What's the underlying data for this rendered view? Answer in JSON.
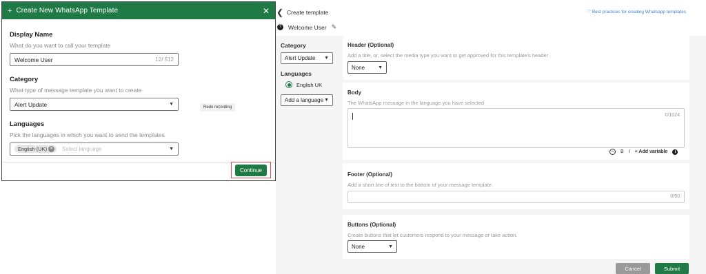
{
  "modal": {
    "title": "Create New WhatsApp Template",
    "plus_glyph": "+",
    "close_glyph": "✕",
    "display_name": {
      "label": "Display Name",
      "help": "What do you want to call your template",
      "value": "Welcome User",
      "counter": "12/ 512"
    },
    "category": {
      "label": "Category",
      "help": "What type of message template you want to create",
      "value": "Alert Update"
    },
    "languages": {
      "label": "Languages",
      "help": "Pick the languages in which you want to send the templates",
      "chip": "English (UK)",
      "placeholder": "Select language"
    },
    "continue_label": "Continue"
  },
  "tooltip": {
    "text": "Redo recording"
  },
  "page": {
    "back_glyph": "❮",
    "title": "Create template",
    "best_practices": "Best practices for creating Whatsapp templates",
    "template_name": "Welcome User",
    "sidebar": {
      "category_label": "Category",
      "category_value": "Alert Update",
      "languages_label": "Languages",
      "language_selected": "English UK",
      "add_language": "Add a language"
    },
    "header_card": {
      "title": "Header (Optional)",
      "help": "Add a title, or, select the media type you want to get approved for this template's header",
      "select_value": "None"
    },
    "body_card": {
      "title": "Body",
      "help": "The WhatsApp message in the language you have selected",
      "counter": "0/1024",
      "bold": "B",
      "italic": "I",
      "add_variable": "+ Add variable"
    },
    "footer_card": {
      "title": "Footer (Optional)",
      "help": "Add a short line of text to the bottom of your message template.",
      "counter": "0/60"
    },
    "buttons_card": {
      "title": "Buttons (Optional)",
      "help": "Create buttons that let customers respond to your message or take action.",
      "select_value": "None"
    },
    "cancel_label": "Cancel",
    "submit_label": "Submit"
  },
  "colors": {
    "brand_green": "#1f7a45",
    "link_blue": "#3d7fd6",
    "highlight_red": "#e05050"
  }
}
